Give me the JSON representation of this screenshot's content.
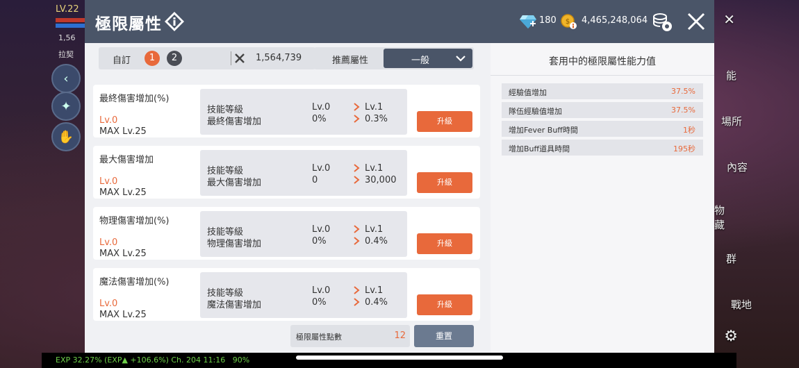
{
  "background": {
    "player_level": "LV.22",
    "power_text": "1,56",
    "location_text": "拉契",
    "exp_bar_text": "EXP 32.27%  (EXP▲ +106.6%)  Ch. 204  11:16",
    "battery_text": "90%",
    "menu_labels": [
      "能",
      "場所",
      "內容",
      "物\n藏",
      "群",
      "戰地"
    ]
  },
  "dialog": {
    "title": "極限屬性",
    "gem_count": "180",
    "gold_count": "4,465,248,064"
  },
  "controls": {
    "preset_label": "自訂",
    "preset_1": "1",
    "preset_2": "2",
    "combat_power": "1,564,739",
    "recommend_label": "推薦屬性",
    "recommend_value": "一般"
  },
  "stats": [
    {
      "name": "最終傷害增加(%)",
      "level": "Lv.0",
      "max": "MAX Lv.25",
      "label1": "技能等級",
      "label2": "最終傷害增加",
      "cur1": "Lv.0",
      "cur2": "0%",
      "next1": "Lv.1",
      "next2": "0.3%",
      "button": "升級"
    },
    {
      "name": "最大傷害增加",
      "level": "Lv.0",
      "max": "MAX Lv.25",
      "label1": "技能等級",
      "label2": "最大傷害增加",
      "cur1": "Lv.0",
      "cur2": "0",
      "next1": "Lv.1",
      "next2": "30,000",
      "button": "升級"
    },
    {
      "name": "物理傷害增加(%)",
      "level": "Lv.0",
      "max": "MAX Lv.25",
      "label1": "技能等級",
      "label2": "物理傷害增加",
      "cur1": "Lv.0",
      "cur2": "0%",
      "next1": "Lv.1",
      "next2": "0.4%",
      "button": "升級"
    },
    {
      "name": "魔法傷害增加(%)",
      "level": "Lv.0",
      "max": "MAX Lv.25",
      "label1": "技能等級",
      "label2": "魔法傷害增加",
      "cur1": "Lv.0",
      "cur2": "0%",
      "next1": "Lv.1",
      "next2": "0.4%",
      "button": "升級"
    }
  ],
  "points": {
    "label": "極限屬性點數",
    "value": "12",
    "reset_label": "重置"
  },
  "right_panel": {
    "title": "套用中的極限屬性能力值",
    "effects": [
      {
        "name": "經驗值增加",
        "value": "37.5%"
      },
      {
        "name": "隊伍經驗值增加",
        "value": "37.5%"
      },
      {
        "name": "增加Fever Buff時間",
        "value": "1秒"
      },
      {
        "name": "增加Buff道具時間",
        "value": "195秒"
      }
    ]
  },
  "colors": {
    "accent": "#e8693b",
    "header": "#4a5568",
    "panel": "#f0f1f4"
  }
}
